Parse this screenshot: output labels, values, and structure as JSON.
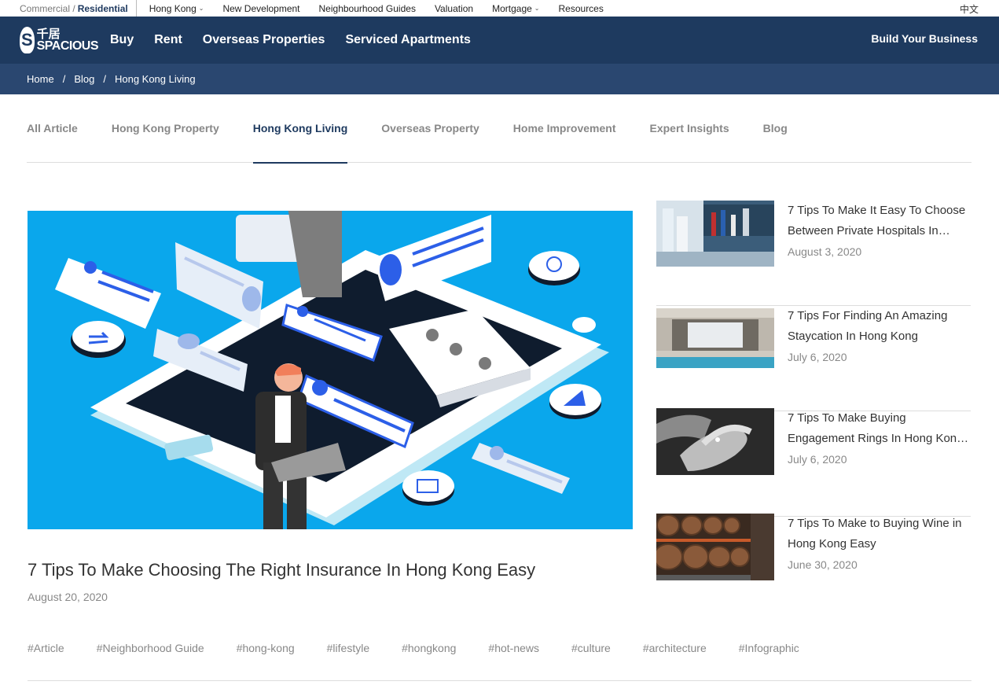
{
  "topbar": {
    "mode_commercial": "Commercial /",
    "mode_residential": "Residential",
    "items": [
      {
        "label": "Hong Kong",
        "dropdown": true
      },
      {
        "label": "New Development",
        "dropdown": false
      },
      {
        "label": "Neighbourhood Guides",
        "dropdown": false
      },
      {
        "label": "Valuation",
        "dropdown": false
      },
      {
        "label": "Mortgage",
        "dropdown": true
      },
      {
        "label": "Resources",
        "dropdown": false
      }
    ],
    "lang": "中文"
  },
  "header": {
    "logo_cn": "千居",
    "logo_en": "SPACIOUS",
    "logo_badge": "S",
    "nav": [
      "Buy",
      "Rent",
      "Overseas Properties",
      "Serviced Apartments"
    ],
    "build": "Build Your Business"
  },
  "breadcrumb": [
    "Home",
    "Blog",
    "Hong Kong Living"
  ],
  "tabs": [
    "All Article",
    "Hong Kong Property",
    "Hong Kong Living",
    "Overseas Property",
    "Home Improvement",
    "Expert Insights",
    "Blog"
  ],
  "active_tab": "Hong Kong Living",
  "featured": {
    "title": "7 Tips To Make Choosing The Right Insurance In Hong Kong Easy",
    "date": "August 20, 2020"
  },
  "side_articles": [
    {
      "title": "7 Tips To Make It Easy To Choose Between Private Hospitals In…",
      "date": "August 3, 2020",
      "thumb": "hospital"
    },
    {
      "title": "7 Tips For Finding An Amazing Staycation In Hong Kong",
      "date": "July 6, 2020",
      "thumb": "pool"
    },
    {
      "title": "7 Tips To Make Buying Engagement Rings In Hong Kon…",
      "date": "July 6, 2020",
      "thumb": "ring"
    },
    {
      "title": "7 Tips To Make to Buying Wine in Hong Kong Easy",
      "date": "June 30, 2020",
      "thumb": "wine"
    }
  ],
  "tags": [
    "#Article",
    "#Neighborhood Guide",
    "#hong-kong",
    "#lifestyle",
    "#hongkong",
    "#hot-news",
    "#culture",
    "#architecture",
    "#Infographic"
  ],
  "colors": {
    "brand": "#1e3a5f",
    "breadcrumb_bg": "#2a4770",
    "hero_bg": "#0aa7ec"
  }
}
